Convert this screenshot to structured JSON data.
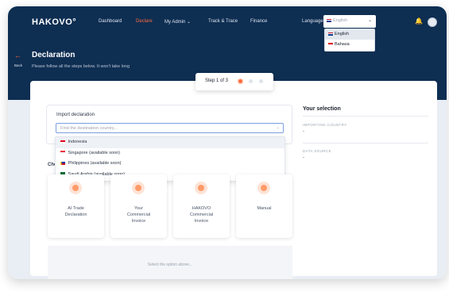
{
  "header": {
    "logo": "HAKOVO°",
    "nav": [
      {
        "label": "Dashboard"
      },
      {
        "label": "Declare"
      },
      {
        "label": "My Admin  ⌄"
      },
      {
        "label": "Track & Trace"
      },
      {
        "label": "Finance"
      }
    ],
    "active_color": "#ff6a3d",
    "language_label": "Language",
    "language_value": "English",
    "language_options": [
      {
        "label": "English",
        "flag": "uk"
      },
      {
        "label": "Bahasa",
        "flag": "id"
      }
    ]
  },
  "page": {
    "back_label": "Back",
    "title": "Declaration",
    "subtitle": "Please follow all the steps below. It won't take long",
    "step": "Step 1 of 3"
  },
  "import": {
    "label": "Import declaration",
    "placeholder": "Find the destination country...",
    "countries": [
      {
        "label": "Indonesia",
        "flag": "id"
      },
      {
        "label": "Singapore (available soon)",
        "flag": "sg"
      },
      {
        "label": "Philippines (available soon)",
        "flag": "ph"
      },
      {
        "label": "Saudi Arabia (available soon)",
        "flag": "sa"
      }
    ]
  },
  "choose_label": "Cho",
  "options": [
    {
      "label": "AI Trade\nDeclaration",
      "icon": "upload-icon"
    },
    {
      "label": "Your\nCommercial\nInvoice",
      "icon": "document-icon"
    },
    {
      "label": "HAKOVO\nCommercial\nInvoice",
      "icon": "invoice-icon"
    },
    {
      "label": "Manual",
      "icon": "pencil-icon"
    }
  ],
  "placeholder_text": "Select the option above...",
  "selection": {
    "title": "Your selection",
    "importing_country_label": "IMPORTING COUNTRY",
    "importing_country_value": "-",
    "data_source_label": "DATA SOURCE",
    "data_source_value": "-"
  }
}
